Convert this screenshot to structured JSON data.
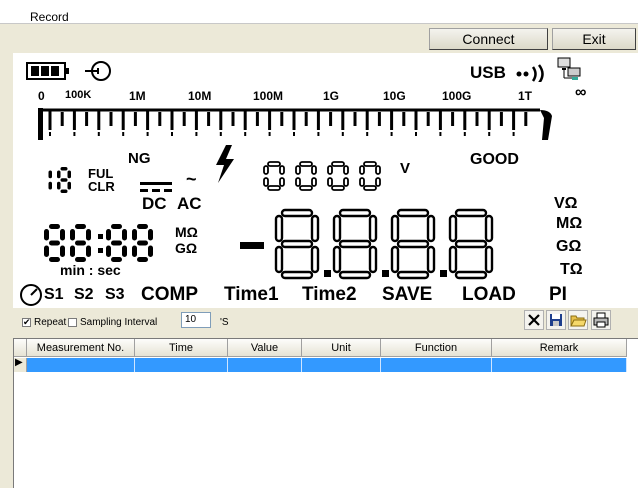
{
  "window": {
    "title": "Record"
  },
  "header": {
    "connect_label": "Connect",
    "exit_label": "Exit"
  },
  "lcd": {
    "usb_label": "USB",
    "scale_labels": [
      "0",
      "100K",
      "1M",
      "10M",
      "100M",
      "1G",
      "10G",
      "100G",
      "1T",
      "∞"
    ],
    "range_digits": "18",
    "ful_label": "FUL",
    "clr_label": "CLR",
    "ng_label": "NG",
    "dc_label": "DC",
    "ac_label": "AC",
    "voltage_digits": "0000",
    "voltage_unit": "V",
    "good_label": "GOOD",
    "timer_digits": "88:88",
    "timer_unit": "min : sec",
    "mo_label": "MΩ",
    "go_label": "GΩ",
    "main_sign": "-",
    "main_digits": "8.8.8.8",
    "units": [
      "VΩ",
      "MΩ",
      "GΩ",
      "TΩ"
    ],
    "status_items": [
      "S1",
      "S2",
      "S3",
      "COMP",
      "Time1",
      "Time2",
      "SAVE",
      "LOAD",
      "PI"
    ]
  },
  "toolbar": {
    "repeat_label": "Repeat",
    "repeat_checked": true,
    "sampling_label": "Sampling Interval",
    "sampling_checked": false,
    "interval_value": "10",
    "interval_unit": "'S",
    "icons": [
      "close-icon",
      "save-icon",
      "open-folder-icon",
      "print-icon"
    ]
  },
  "table": {
    "columns": [
      "Measurement No.",
      "Time",
      "Value",
      "Unit",
      "Function",
      "Remark"
    ],
    "selected_row_marker": "▶"
  }
}
